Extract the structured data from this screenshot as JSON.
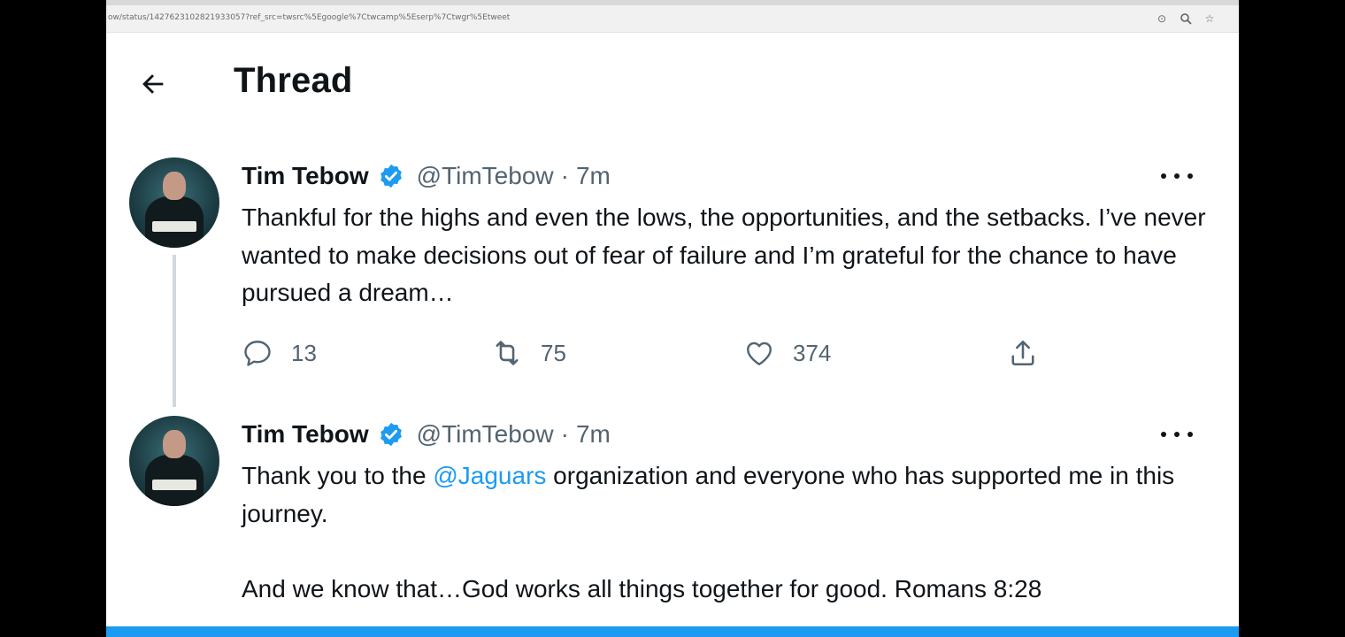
{
  "browser": {
    "url": "ow/status/1427623102821933057?ref_src=twsrc%5Egoogle%7Ctwcamp%5Eserp%7Ctwgr%5Etweet"
  },
  "header": {
    "title": "Thread"
  },
  "tweets": [
    {
      "author": "Tim Tebow",
      "handle": "@TimTebow",
      "separator": "·",
      "time": "7m",
      "text": "Thankful for the highs and even the lows, the opportunities, and the setbacks. I’ve never wanted to make decisions out of fear of failure and I’m grateful for the chance to have pursued a dream…",
      "replies": "13",
      "retweets": "75",
      "likes": "374"
    },
    {
      "author": "Tim Tebow",
      "handle": "@TimTebow",
      "separator": "·",
      "time": "7m",
      "text_before": "Thank you to the ",
      "mention": "@Jaguars",
      "text_after": " organization and everyone who has supported me in this journey.\n\nAnd we know that…God works all things together for good. Romans 8:28"
    }
  ],
  "colors": {
    "accent": "#1d9bf0",
    "secondary_text": "#536471",
    "primary_text": "#0f1419"
  },
  "icons": [
    "back-arrow-icon",
    "verified-badge-icon",
    "more-icon",
    "reply-icon",
    "retweet-icon",
    "like-icon",
    "share-icon"
  ]
}
